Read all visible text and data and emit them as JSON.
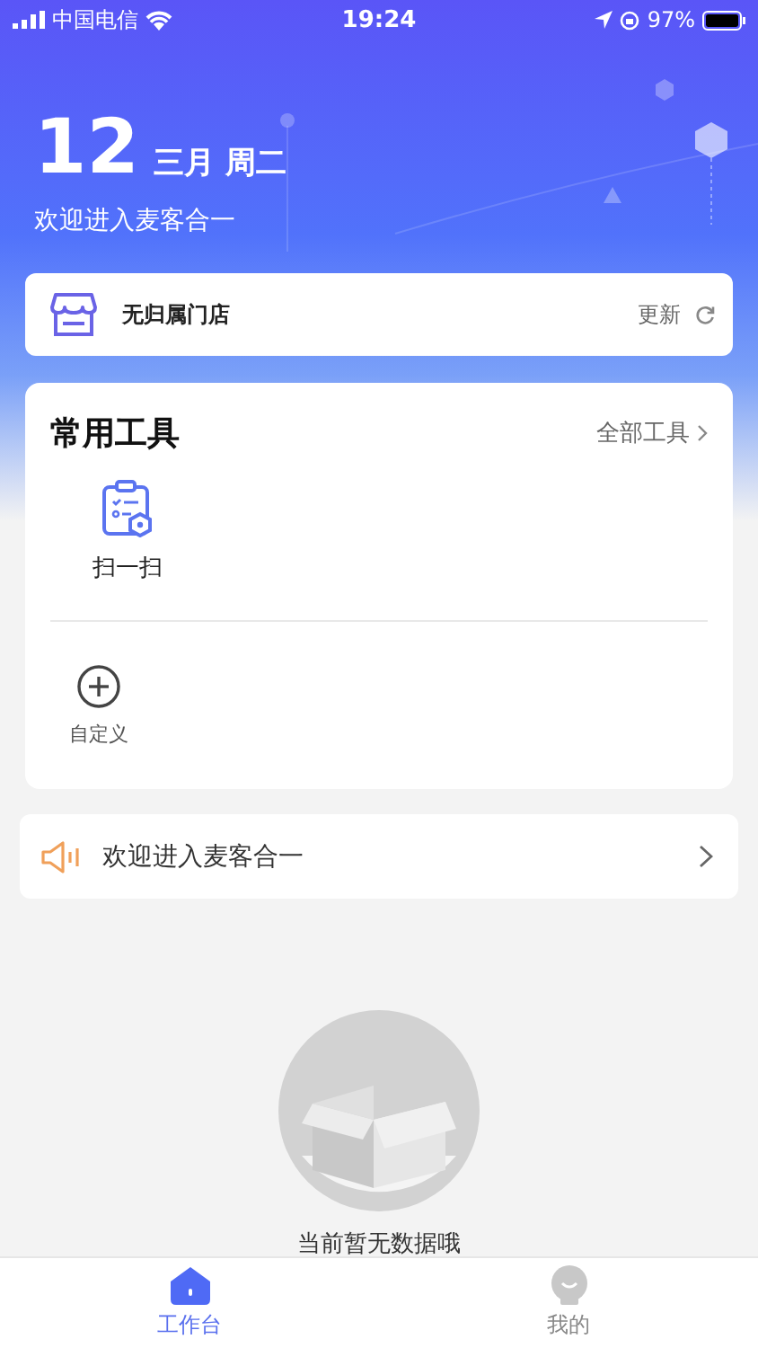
{
  "status_bar": {
    "carrier": "中国电信",
    "time": "19:24",
    "battery": "97%"
  },
  "header": {
    "day": "12",
    "month_weekday": "三月 周二",
    "welcome": "欢迎进入麦客合一"
  },
  "store": {
    "name": "无归属门店",
    "action": "更新"
  },
  "tools": {
    "title": "常用工具",
    "more": "全部工具",
    "items": [
      {
        "label": "扫一扫",
        "kind": "scan"
      }
    ],
    "custom": {
      "label": "自定义"
    }
  },
  "notice": {
    "text": "欢迎进入麦客合一"
  },
  "empty": {
    "message": "当前暂无数据哦"
  },
  "tabs": [
    {
      "label": "工作台",
      "kind": "home",
      "selected": true
    },
    {
      "label": "我的",
      "kind": "profile",
      "selected": false
    }
  ]
}
